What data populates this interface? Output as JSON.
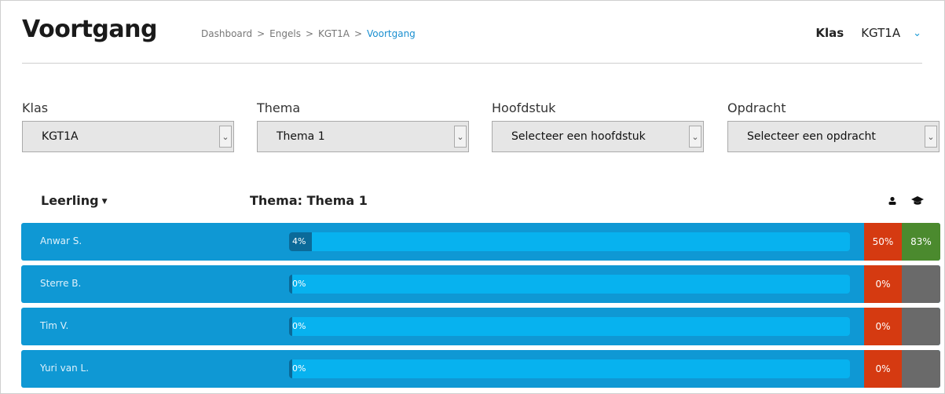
{
  "header": {
    "title": "Voortgang",
    "breadcrumb": [
      "Dashboard",
      "Engels",
      "KGT1A",
      "Voortgang"
    ],
    "breadcrumb_sep": ">",
    "klas_label": "Klas",
    "klas_value": "KGT1A"
  },
  "filters": {
    "klas": {
      "label": "Klas",
      "value": "KGT1A"
    },
    "thema": {
      "label": "Thema",
      "value": "Thema 1"
    },
    "hoofdstuk": {
      "label": "Hoofdstuk",
      "value": "Selecteer een hoofdstuk"
    },
    "opdracht": {
      "label": "Opdracht",
      "value": "Selecteer een opdracht"
    }
  },
  "list": {
    "col_student": "Leerling",
    "col_theme": "Thema: Thema 1",
    "icons": [
      "person-icon",
      "graduation-cap-icon"
    ]
  },
  "students": [
    {
      "name": "Anwar S.",
      "progress": 4,
      "progress_label": "4%",
      "self_score": "50%",
      "grade_score": "83%",
      "grade_color": "#4b8a2e"
    },
    {
      "name": "Sterre B.",
      "progress": 0,
      "progress_label": "0%",
      "self_score": "0%",
      "grade_score": "",
      "grade_color": "#6a6a6a"
    },
    {
      "name": "Tim V.",
      "progress": 0,
      "progress_label": "0%",
      "self_score": "0%",
      "grade_score": "",
      "grade_color": "#6a6a6a"
    },
    {
      "name": "Yuri van L.",
      "progress": 0,
      "progress_label": "0%",
      "self_score": "0%",
      "grade_score": "",
      "grade_color": "#6a6a6a"
    }
  ],
  "colors": {
    "row_bg": "#0f98d4",
    "track": "#07b2ef",
    "fill": "#0b6a99",
    "self_score_bg": "#d53a11",
    "accent": "#1a8fd0"
  }
}
